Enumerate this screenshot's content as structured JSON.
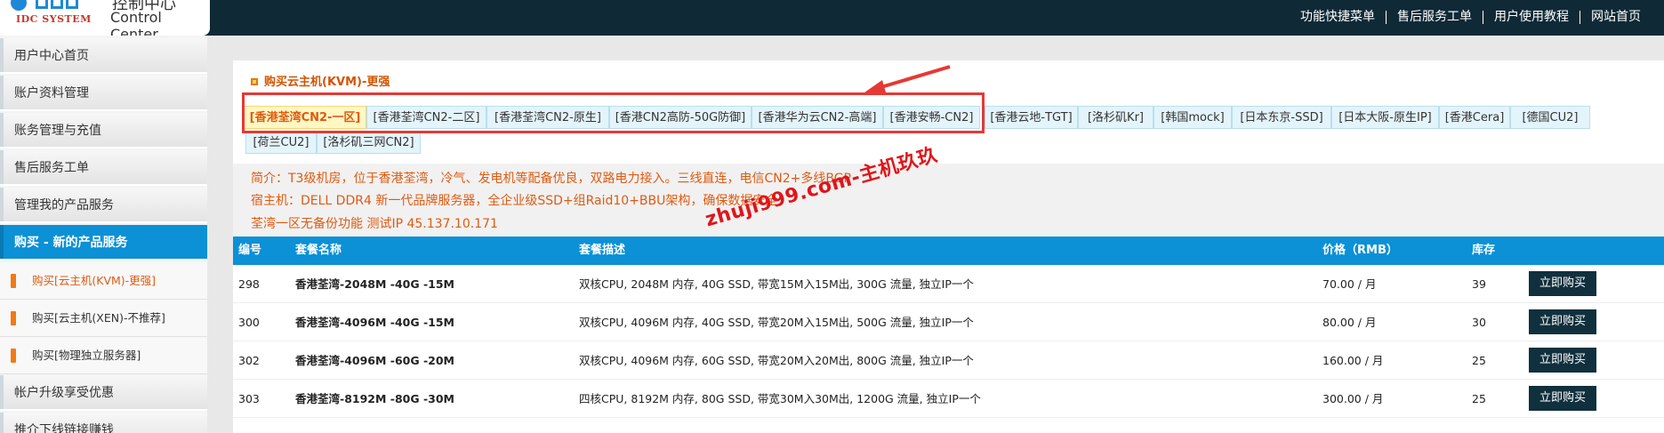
{
  "logo": {
    "cn_title": "控制中心",
    "system": "IDC SYSTEM",
    "subtitle": "Control Center"
  },
  "topnav": [
    "功能快捷菜单",
    "售后服务工单",
    "用户使用教程",
    "网站首页"
  ],
  "sidebar": {
    "items": [
      {
        "label": "用户中心首页"
      },
      {
        "label": "账户资料管理"
      },
      {
        "label": "账务管理与充值"
      },
      {
        "label": "售后服务工单"
      },
      {
        "label": "管理我的产品服务"
      },
      {
        "label": "购买 - 新的产品服务"
      }
    ],
    "subitems": [
      {
        "label": "购买[云主机(KVM)-更强]"
      },
      {
        "label": "购买[云主机(XEN)-不推荐]"
      },
      {
        "label": "购买[物理独立服务器]"
      }
    ],
    "more": [
      {
        "label": "帐户升级享受优惠"
      },
      {
        "label": "推介下线链接赚钱"
      }
    ]
  },
  "main": {
    "title": "购买云主机(KVM)-更强",
    "tabs": [
      "[香港荃湾CN2-一区]",
      "[香港荃湾CN2-二区]",
      "[香港荃湾CN2-原生]",
      "[香港CN2高防-50G防御]",
      "[香港华为云CN2-高端]",
      "[香港安畅-CN2]",
      "[香港云地-TGT]",
      "[洛杉矶Kr]",
      "[韩国mock]",
      "[日本东京-SSD]",
      "[日本大阪-原生IP]",
      "[香港Cera]",
      "[德国CU2]",
      "[荷兰CU2]",
      "[洛杉矶三网CN2]"
    ],
    "description": [
      "简介：T3级机房，位于香港荃湾，冷气、发电机等配备优良，双路电力接入。三线直连，电信CN2+多线BGP",
      "宿主机：DELL DDR4 新一代品牌服务器，全企业级SSD+组Raid10+BBU架构，确保数据安全",
      "荃湾一区无备份功能 测试IP 45.137.10.171"
    ],
    "watermark": "zhuji999.com-主机玖玖",
    "table": {
      "headers": [
        "编号",
        "套餐名称",
        "套餐描述",
        "价格（RMB）",
        "库存"
      ],
      "rows": [
        {
          "id": "298",
          "name": "香港荃湾-2048M -40G -15M",
          "desc": "双核CPU, 2048M 内存, 40G SSD, 带宽15M入15M出, 300G 流量, 独立IP一个",
          "price": "70.00 / 月",
          "stock": "39",
          "button": "立即购买"
        },
        {
          "id": "300",
          "name": "香港荃湾-4096M -40G -15M",
          "desc": "双核CPU, 4096M 内存, 40G SSD, 带宽20M入15M出, 500G 流量, 独立IP一个",
          "price": "80.00 / 月",
          "stock": "30",
          "button": "立即购买"
        },
        {
          "id": "302",
          "name": "香港荃湾-4096M -60G -20M",
          "desc": "双核CPU, 4096M 内存, 60G SSD, 带宽20M入20M出, 800G 流量, 独立IP一个",
          "price": "160.00 / 月",
          "stock": "25",
          "button": "立即购买"
        },
        {
          "id": "303",
          "name": "香港荃湾-8192M -80G -30M",
          "desc": "四核CPU, 8192M 内存, 80G SSD, 带宽30M入30M出, 1200G 流量, 独立IP一个",
          "price": "300.00 / 月",
          "stock": "25",
          "button": "立即购买"
        }
      ]
    }
  },
  "colors": {
    "topbar": "#0f2a36",
    "accent": "#0c90d6",
    "highlight_text": "#e05a10",
    "annotation_red": "#e53935"
  }
}
